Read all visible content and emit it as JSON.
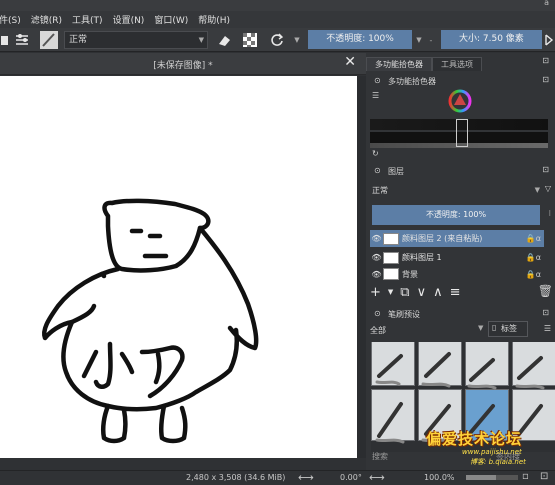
{
  "window": {
    "title_fragment": "ā"
  },
  "menubar": {
    "items": [
      "件(S)",
      "滤镜(R)",
      "工具(T)",
      "设置(N)",
      "窗口(W)",
      "帮助(H)"
    ]
  },
  "toolbar": {
    "blend_mode": "正常",
    "opacity": "不透明度: 100%",
    "size": "大小: 7.50 像素"
  },
  "document": {
    "tab_title": "[未保存图像] *",
    "close_glyph": "✕",
    "drawing_text": "小丫"
  },
  "docker": {
    "tabs": [
      "多功能拾色器",
      "工具选项"
    ],
    "color_panel_title": "多功能拾色器",
    "layers_title": "图层",
    "layer_blend": "正常",
    "layer_opacity": "不透明度: 100%",
    "layers": [
      {
        "name": "颜料图层 2 (来自粘贴)",
        "selected": true
      },
      {
        "name": "颜料图层 1",
        "selected": false
      },
      {
        "name": "背景",
        "selected": false
      }
    ],
    "brush_presets_title": "笔刷预设",
    "brush_filter": "全部",
    "tag_label": "标签",
    "search_label": "搜索",
    "search_hint": "签内搜"
  },
  "statusbar": {
    "dimensions": "2,480 x 3,508 (34.6 MiB)",
    "rotation": "0.00°",
    "zoom": "100.0%"
  },
  "watermark": {
    "line1": "偏爱技术论坛",
    "line2": "www.paijishu.net",
    "line3": "博客: b.qiaia.net"
  },
  "colors": {
    "accent": "#5c7ea6",
    "background": "#2f3134",
    "canvas": "#ffffff"
  }
}
